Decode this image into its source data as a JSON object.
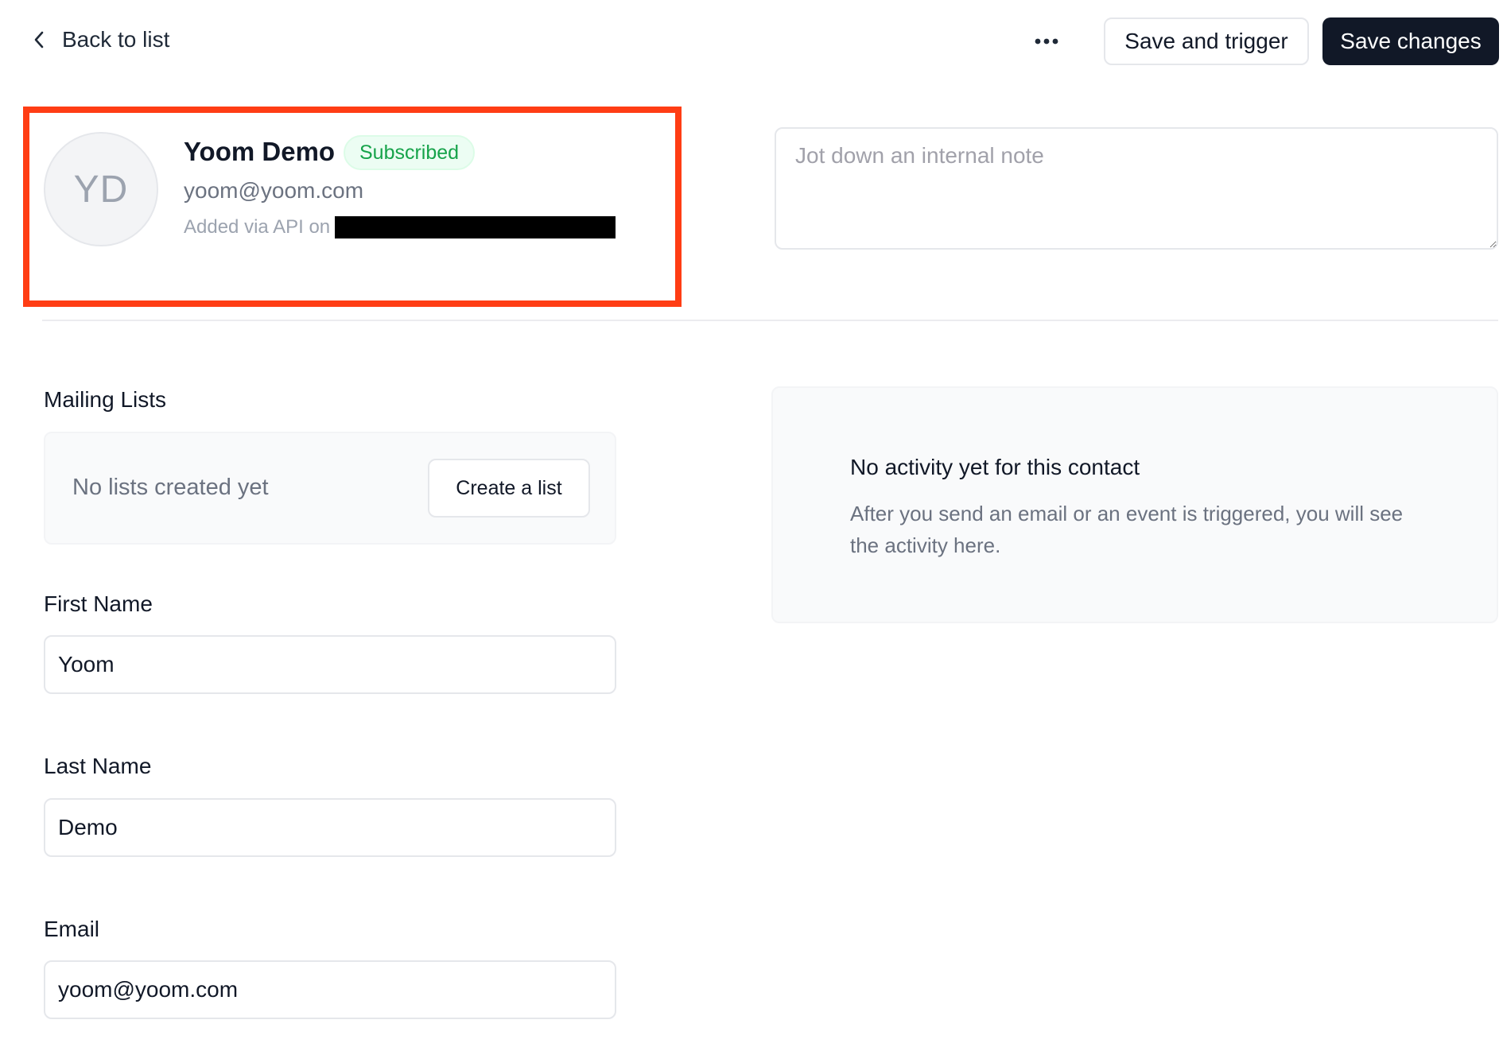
{
  "header": {
    "back_label": "Back to list",
    "more_icon": "more-horizontal-icon",
    "save_trigger_label": "Save and trigger",
    "save_changes_label": "Save changes"
  },
  "contact": {
    "initials": "YD",
    "name": "Yoom Demo",
    "status": "Subscribed",
    "email": "yoom@yoom.com",
    "added_via": "Added via API on"
  },
  "note": {
    "placeholder": "Jot down an internal note",
    "value": ""
  },
  "mailing_lists": {
    "title": "Mailing Lists",
    "empty_text": "No lists created yet",
    "create_label": "Create a list"
  },
  "fields": {
    "first_name": {
      "label": "First Name",
      "value": "Yoom"
    },
    "last_name": {
      "label": "Last Name",
      "value": "Demo"
    },
    "email": {
      "label": "Email",
      "value": "yoom@yoom.com"
    }
  },
  "activity": {
    "title": "No activity yet for this contact",
    "description": "After you send an email or an event is triggered, you will see the activity here."
  },
  "colors": {
    "primary": "#111827",
    "status_green": "#16a34a",
    "highlight": "#ff3d14"
  }
}
